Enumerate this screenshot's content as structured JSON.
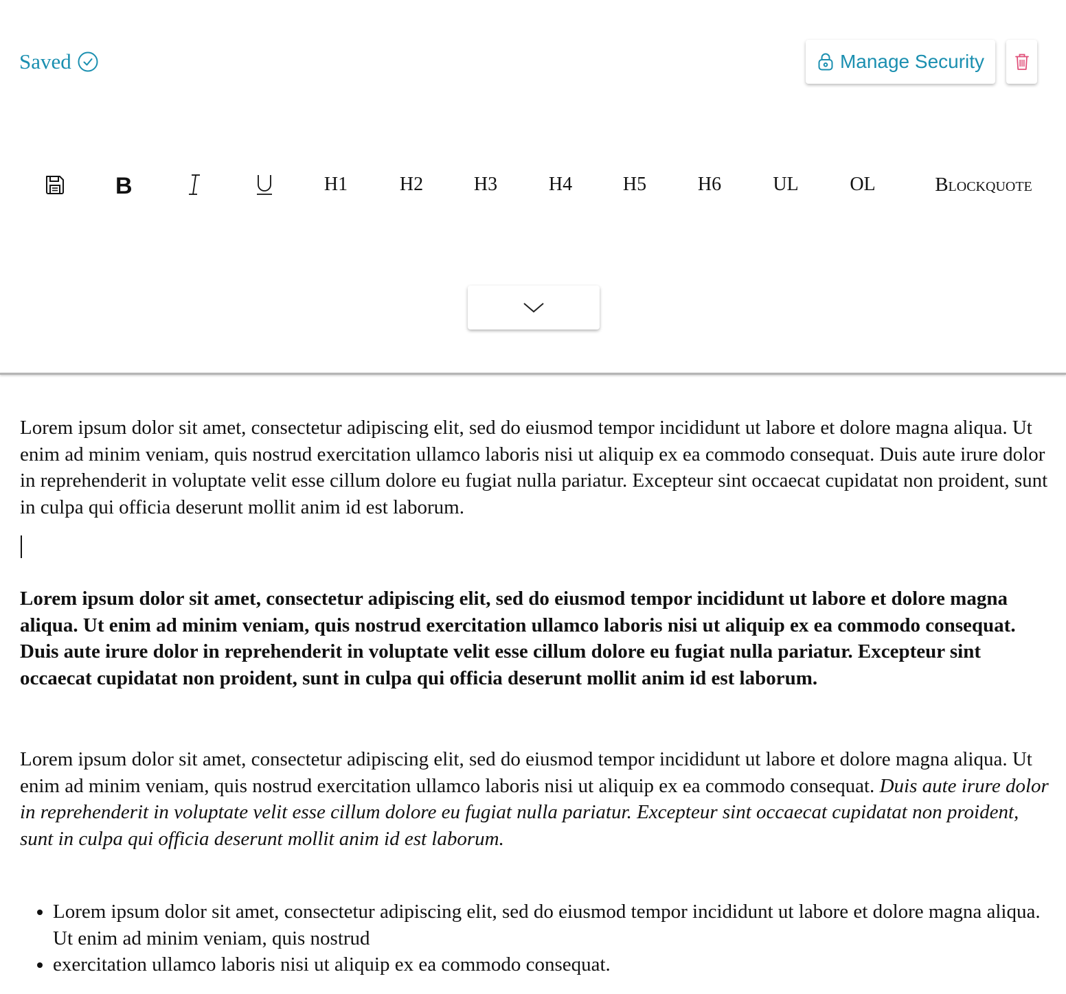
{
  "header": {
    "status_label": "Saved",
    "security_button_label": "Manage Security",
    "accent_color": "#1a8fb0",
    "delete_color": "#e0507a",
    "icons": [
      "check-circle-icon",
      "lock-icon",
      "trash-icon"
    ]
  },
  "toolbar": {
    "items": [
      {
        "name": "save",
        "icon": "floppy-disk-icon",
        "label": ""
      },
      {
        "name": "bold",
        "icon": "bold-icon",
        "label": "B"
      },
      {
        "name": "italic",
        "icon": "italic-icon",
        "label": "I"
      },
      {
        "name": "underline",
        "icon": "underline-icon",
        "label": "U"
      },
      {
        "name": "h1",
        "label": "H1"
      },
      {
        "name": "h2",
        "label": "H2"
      },
      {
        "name": "h3",
        "label": "H3"
      },
      {
        "name": "h4",
        "label": "H4"
      },
      {
        "name": "h5",
        "label": "H5"
      },
      {
        "name": "h6",
        "label": "H6"
      },
      {
        "name": "ul",
        "label": "UL"
      },
      {
        "name": "ol",
        "label": "OL"
      },
      {
        "name": "blockquote",
        "label": "Blockquote"
      }
    ],
    "collapse_icon": "chevron-down-icon"
  },
  "document": {
    "paragraph_1": "Lorem ipsum dolor  sit amet, consectetur adipiscing elit, sed do eiusmod tempor incididunt  ut labore et dolore magna aliqua. Ut enim ad minim veniam, quis nostrud  exercitation ullamco laboris nisi ut aliquip ex ea commodo consequat.  Duis aute irure dolor in reprehenderit in voluptate velit esse cillum  dolore eu fugiat nulla pariatur. Excepteur sint occaecat cupidatat non  proident, sunt in culpa qui officia deserunt mollit anim id est laborum.",
    "paragraph_2_bold": "Lorem ipsum dolor  sit amet, consectetur adipiscing elit, sed do eiusmod tempor incididunt  ut labore et dolore magna aliqua. Ut enim ad minim veniam, quis nostrud  exercitation ullamco laboris nisi ut aliquip ex ea commodo consequat.  Duis aute irure dolor in reprehenderit in voluptate velit esse cillum  dolore eu fugiat nulla pariatur. Excepteur sint occaecat cupidatat non  proident, sunt in culpa qui officia deserunt mollit anim id est laborum.",
    "paragraph_3_plain": "Lorem ipsum dolor  sit amet, consectetur adipiscing elit, sed do eiusmod tempor incididunt  ut labore et dolore magna aliqua. Ut enim ad minim veniam, quis nostrud  exercitation ullamco laboris nisi ut aliquip ex ea commodo consequat.  ",
    "paragraph_3_italic": "Duis aute irure dolor in reprehenderit in voluptate velit esse cillum  dolore eu fugiat nulla pariatur. Excepteur sint occaecat cupidatat non  proident, sunt in culpa qui officia deserunt mollit anim id est laborum.",
    "list_items": [
      "Lorem ipsum dolor  sit amet, consectetur adipiscing elit, sed do eiusmod tempor incididunt  ut labore et dolore magna aliqua. Ut enim ad minim veniam, quis nostrud",
      "exercitation ullamco laboris nisi ut aliquip ex ea commodo consequat."
    ]
  }
}
